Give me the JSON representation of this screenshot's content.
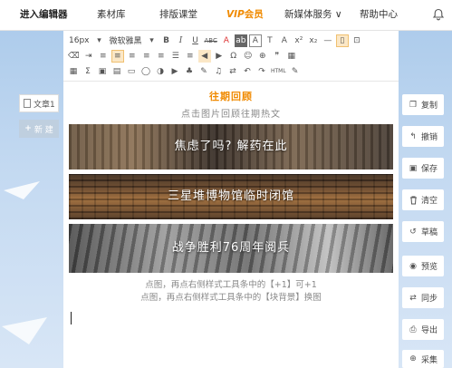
{
  "nav": {
    "items": [
      {
        "label": "进入编辑器",
        "active": true
      },
      {
        "label": "素材库"
      },
      {
        "label": "排版课堂"
      },
      {
        "label": "会员",
        "vip": "VIP"
      },
      {
        "label": "新媒体服务 ∨"
      },
      {
        "label": "帮助中心"
      }
    ]
  },
  "toolbar": {
    "font_size": "16px",
    "font_family": "微软雅黑",
    "row1": [
      "B",
      "I",
      "U",
      "ABC",
      "A",
      "ab",
      "A",
      "T",
      "A",
      "x²",
      "x₂",
      "—"
    ],
    "row2": [
      "⌫",
      "⇥",
      "≡",
      "≡",
      "≡",
      "≡",
      "≡",
      "☰",
      "≡",
      "◀",
      "▶",
      "Ω",
      "☺",
      "⊕",
      "❞",
      "▦"
    ],
    "row3": [
      "▦",
      "Σ",
      "▣",
      "▤",
      "▭",
      "◯",
      "◑",
      "▶",
      "♣",
      "✎",
      "♫",
      "⇄",
      "↶",
      "↷",
      "HTML",
      "✎"
    ]
  },
  "content": {
    "title": "往期回顾",
    "subtitle": "点击图片回顾往期热文",
    "banners": [
      {
        "label": "焦虑了吗? 解药在此"
      },
      {
        "label": "三星堆博物馆临时闭馆"
      },
      {
        "label": "战争胜利76周年阅兵"
      }
    ],
    "hint1": "点图，再点右侧样式工具条中的【+1】可+1",
    "hint2": "点图，再点右侧样式工具条中的【块背景】换图"
  },
  "left": {
    "tab_label": "文章1",
    "new_label": "新 建"
  },
  "right_buttons": [
    {
      "label": "复制",
      "icon": "copy-icon",
      "glyph": "❐"
    },
    {
      "label": "撤销",
      "icon": "undo-icon",
      "glyph": "↰"
    },
    {
      "label": "保存",
      "icon": "save-icon",
      "glyph": "▣"
    },
    {
      "label": "清空",
      "icon": "trash-icon",
      "glyph": "🗑"
    },
    {
      "label": "草稿",
      "icon": "history-icon",
      "glyph": "↺"
    },
    {
      "label": "预览",
      "icon": "eye-icon",
      "glyph": "◉"
    },
    {
      "label": "同步",
      "icon": "sync-icon",
      "glyph": "⇄"
    },
    {
      "label": "导出",
      "icon": "export-icon",
      "glyph": "⎙"
    },
    {
      "label": "采集",
      "icon": "search-icon",
      "glyph": "⊕"
    }
  ],
  "colors": {
    "accent": "#f08a00",
    "background": "#c3d9f1"
  }
}
